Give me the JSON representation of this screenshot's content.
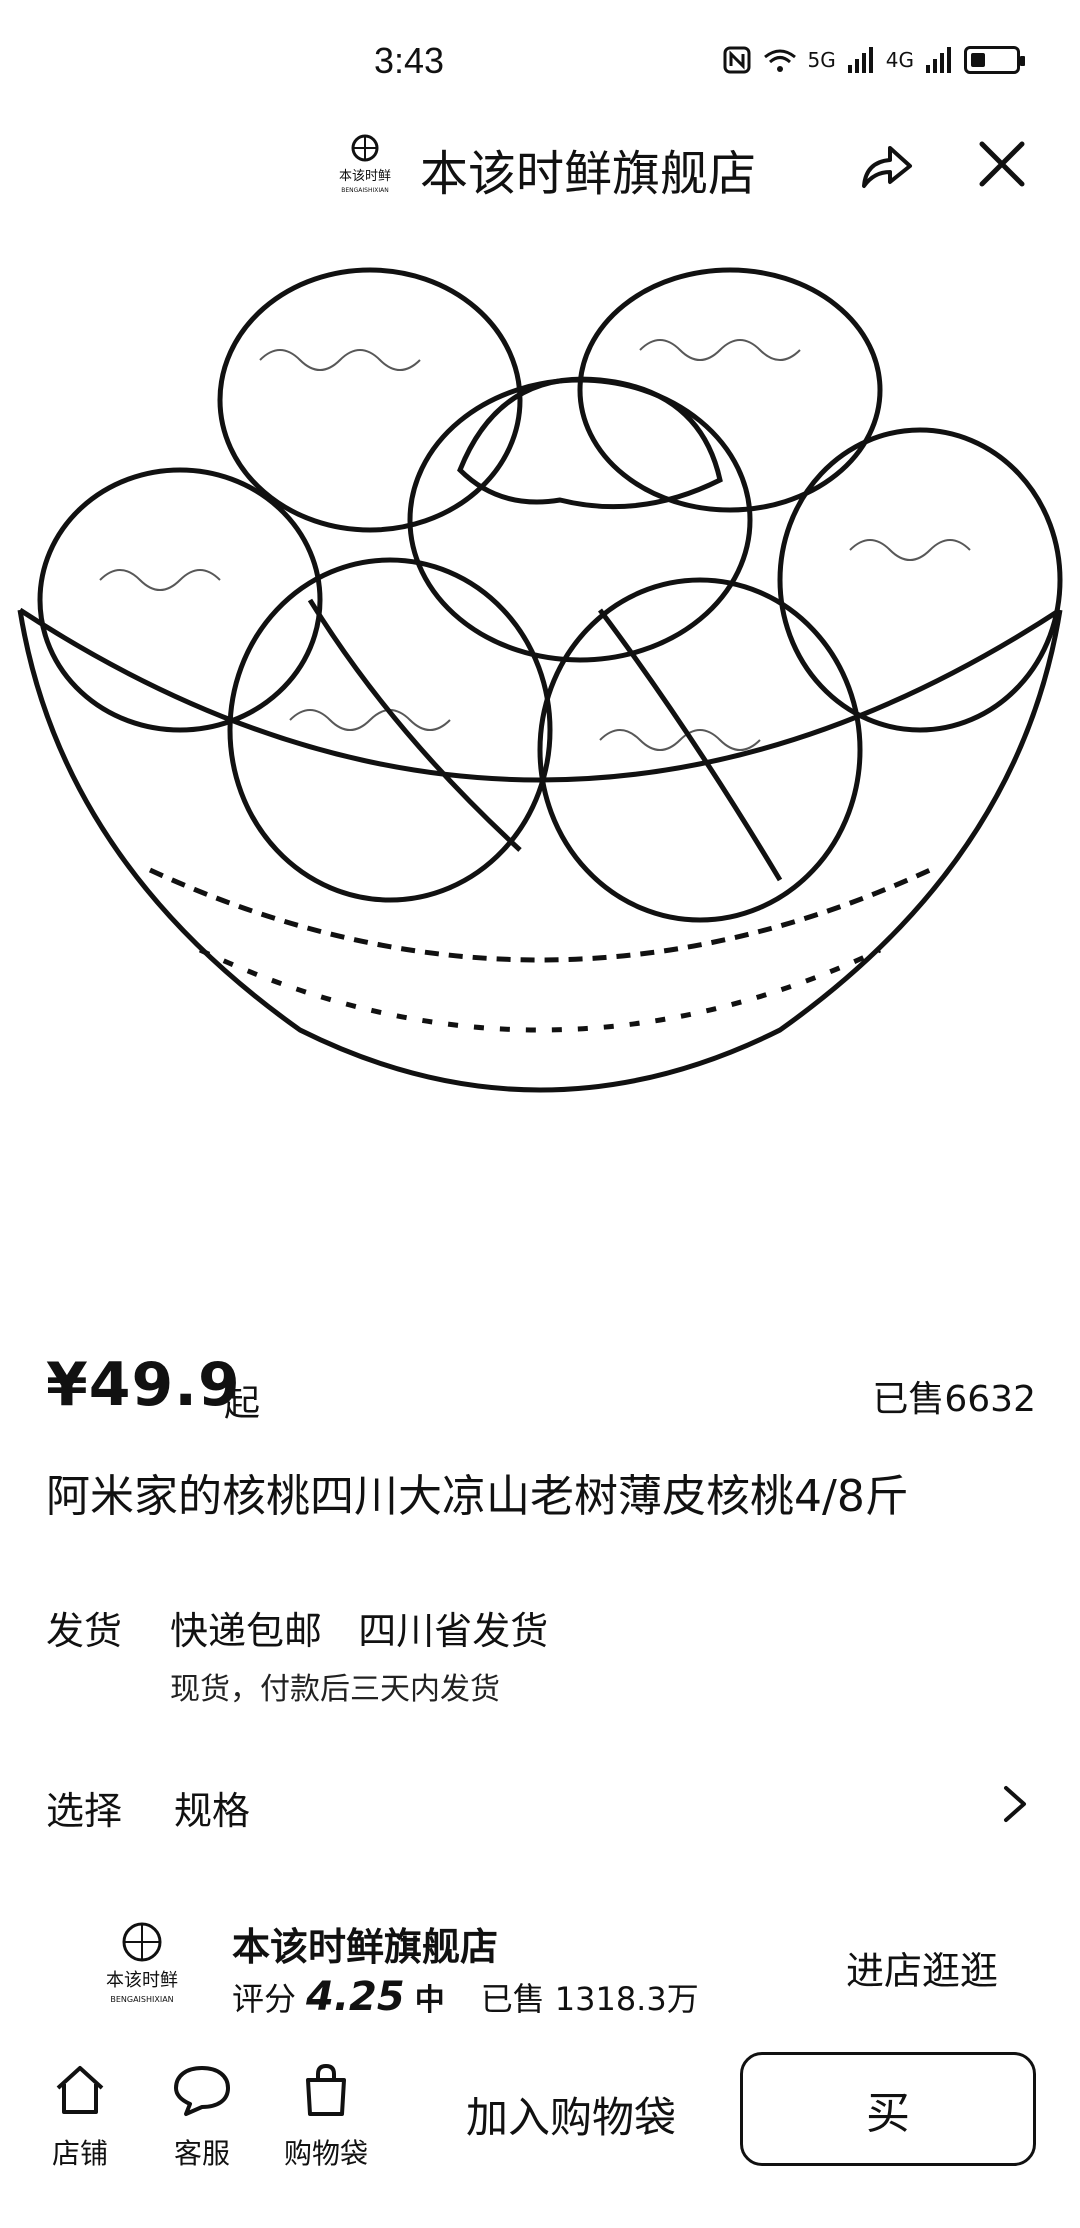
{
  "status_bar": {
    "time": "3:43",
    "signal_5g": "5G",
    "signal_4g": "4G"
  },
  "header": {
    "title": "本该时鲜旗舰店",
    "logo_text": "本该时鲜",
    "logo_subtext": "BENGAISHIXIAN"
  },
  "product": {
    "price": "¥49.9",
    "price_suffix": "起",
    "sold": "已售6632",
    "title": "阿米家的核桃四川大凉山老树薄皮核桃4/8斤"
  },
  "shipping": {
    "label": "发货",
    "main": "快递包邮   四川省发货",
    "sub": "现货，付款后三天内发货"
  },
  "select": {
    "label": "选择",
    "value": "规格"
  },
  "store": {
    "name": "本该时鲜旗舰店",
    "rating_label": "评分",
    "rating": "4.25",
    "level": "中",
    "sold_label": "已售",
    "sold_count": "1318.3万",
    "visit_label": "进店逛逛"
  },
  "bottom_bar": {
    "store_label": "店铺",
    "service_label": "客服",
    "bag_label": "购物袋",
    "add_cart_label": "加入购物袋",
    "buy_label": "买"
  }
}
